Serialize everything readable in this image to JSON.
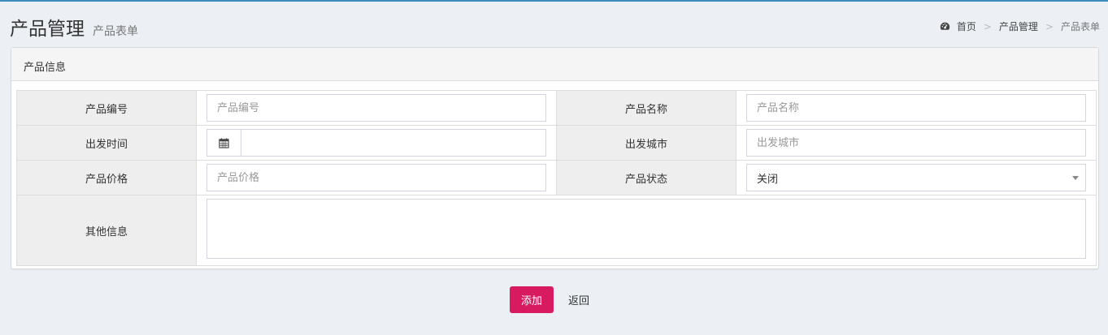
{
  "colors": {
    "top_bar": "#3c8dbc",
    "background": "#ecf0f5",
    "add_button": "#d81b60",
    "label_cell": "#eeeeee"
  },
  "header": {
    "title": "产品管理",
    "subtitle": "产品表单"
  },
  "breadcrumb": {
    "icon": "dashboard-icon",
    "items": [
      "首页",
      "产品管理",
      "产品表单"
    ],
    "separator": ">"
  },
  "box": {
    "title": "产品信息"
  },
  "form": {
    "product_code": {
      "label": "产品编号",
      "placeholder": "产品编号",
      "value": ""
    },
    "product_name": {
      "label": "产品名称",
      "placeholder": "产品名称",
      "value": ""
    },
    "depart_time": {
      "label": "出发时间",
      "icon": "calendar-icon",
      "value": ""
    },
    "depart_city": {
      "label": "出发城市",
      "placeholder": "出发城市",
      "value": ""
    },
    "product_price": {
      "label": "产品价格",
      "placeholder": "产品价格",
      "value": ""
    },
    "product_status": {
      "label": "产品状态",
      "selected": "关闭"
    },
    "other_info": {
      "label": "其他信息",
      "value": ""
    }
  },
  "actions": {
    "add_label": "添加",
    "back_label": "返回"
  }
}
